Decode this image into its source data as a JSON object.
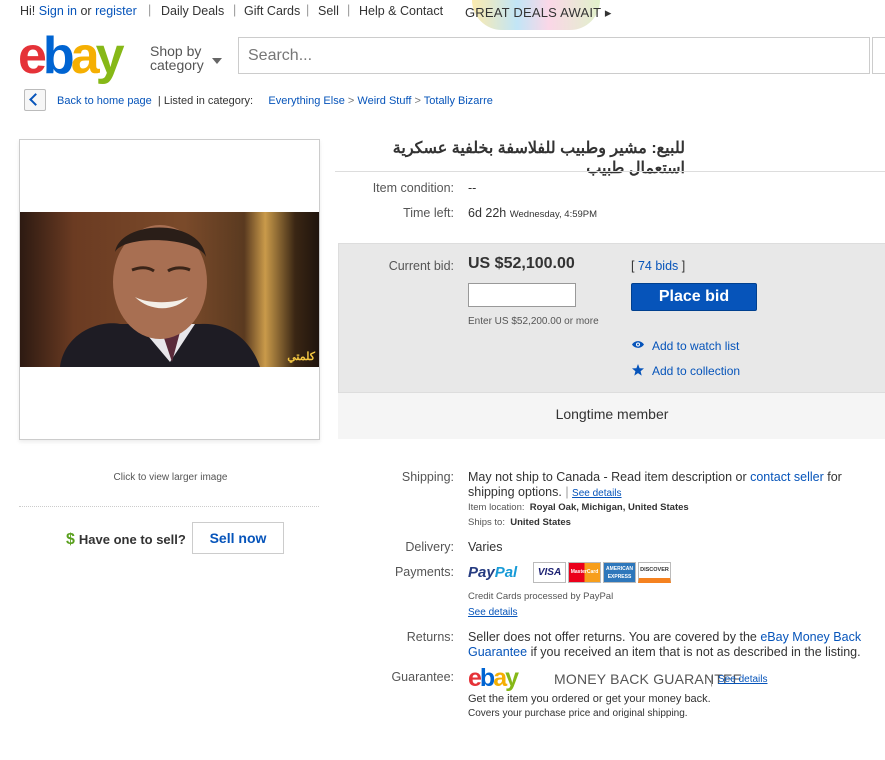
{
  "topbar": {
    "greeting": "Hi!",
    "sign_in": "Sign in",
    "or": "or",
    "register": "register",
    "links": [
      "Daily Deals",
      "Gift Cards",
      "Sell",
      "Help & Contact"
    ],
    "promo": "GREAT DEALS AWAIT ▸"
  },
  "header": {
    "logo": [
      "e",
      "b",
      "a",
      "y"
    ],
    "shop_by_line1": "Shop by",
    "shop_by_line2": "category",
    "search_placeholder": "Search..."
  },
  "breadcrumb": {
    "back": "Back to home page",
    "listed": "| Listed in category:",
    "items": [
      "Everything Else",
      "Weird Stuff",
      "Totally Bizarre"
    ],
    "separator": ">"
  },
  "image": {
    "watermark": "كلمتي",
    "click_text": "Click to view larger image"
  },
  "sell": {
    "symbol": "$",
    "prompt": "Have one to sell?",
    "button": "Sell now"
  },
  "item": {
    "title": "للبيع: مشير وطبيب للفلاسفة بخلفية عسكرية استعمال طبيب",
    "condition_label": "Item condition:",
    "condition_value": "--",
    "time_left_label": "Time left:",
    "time_left_value": "6d 22h",
    "time_left_when": "Wednesday, 4:59PM"
  },
  "bid": {
    "current_label": "Current bid:",
    "price": "US $52,100.00",
    "bids_open": "[",
    "bids_link": "74 bids",
    "bids_close": "]",
    "enter_text": "Enter US $52,200.00 or more",
    "place_bid": "Place bid",
    "watch": "Add to watch list",
    "collection": "Add to collection",
    "member": "Longtime member"
  },
  "shipping": {
    "label": "Shipping:",
    "text": "May not ship to Canada - Read item description or",
    "contact": "contact seller",
    "text2": "for",
    "text3": "shipping options.",
    "bar": "|",
    "see_details": "See details",
    "location_label": "Item location:",
    "location": "Royal Oak, Michigan, United States",
    "ships_label": "Ships to:",
    "ships": "United States"
  },
  "delivery": {
    "label": "Delivery:",
    "value": "Varies"
  },
  "payments": {
    "label": "Payments:",
    "paypal1": "Pay",
    "paypal2": "Pal",
    "cards": [
      "VISA",
      "MasterCard",
      "AMERICAN EXPRESS",
      "DISCOVER"
    ],
    "note": "Credit Cards processed by PayPal",
    "see_details": "See details"
  },
  "returns": {
    "label": "Returns:",
    "text": "Seller does not offer returns. You are covered by the",
    "link1": "eBay Money Back",
    "link2": "Guarantee",
    "text2": "if you received an item that is not as described in the listing."
  },
  "guarantee": {
    "label": "Guarantee:",
    "mbg": "MONEY BACK GUARANTEE",
    "bar": "|",
    "see_details": "See details",
    "line1": "Get the item you ordered or get your money back.",
    "line2": "Covers your purchase price and original shipping."
  },
  "colors": {
    "accent": "#0654ba",
    "bid_button": "#0654ba",
    "dollar": "#5aa01f"
  }
}
